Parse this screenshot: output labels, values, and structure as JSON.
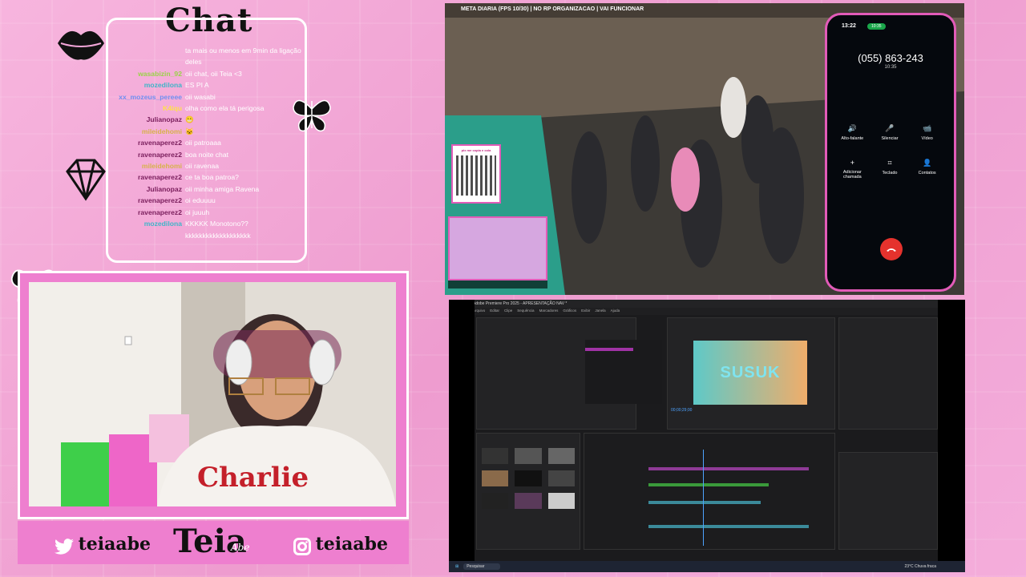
{
  "chat": {
    "title": "Chat",
    "messages": [
      {
        "user": "",
        "text": "ta mais ou menos em 9min da ligação deles",
        "color": "#ffffff"
      },
      {
        "user": "wasabizin_92",
        "text": "oii chat, oii Teia <3",
        "color": "#9ad34a"
      },
      {
        "user": "mozedilona",
        "text": "ES PI A",
        "color": "#3fb6c9"
      },
      {
        "user": "xx_mozeus_pereee",
        "text": "oii wasabi",
        "color": "#6f8ef0"
      },
      {
        "user": "K4iqu",
        "text": "olha como ela tá perigosa",
        "color": "#ffe04a"
      },
      {
        "user": "Julianopaz",
        "text": "😬",
        "color": "#7a1e5c"
      },
      {
        "user": "mileidehomi",
        "text": "🐱",
        "color": "#d7b24a"
      },
      {
        "user": "ravenaperez2",
        "text": "oii patroaaa",
        "color": "#7a1e5c"
      },
      {
        "user": "ravenaperez2",
        "text": "boa noite chat",
        "color": "#7a1e5c"
      },
      {
        "user": "mileidehomi",
        "text": "oii ravenaa",
        "color": "#d7b24a"
      },
      {
        "user": "ravenaperez2",
        "text": "ce ta boa patroa?",
        "color": "#7a1e5c"
      },
      {
        "user": "Julianopaz",
        "text": "oii minha amiga Ravena",
        "color": "#7a1e5c"
      },
      {
        "user": "ravenaperez2",
        "text": "oi eduuuu",
        "color": "#7a1e5c"
      },
      {
        "user": "ravenaperez2",
        "text": "oi juuuh",
        "color": "#7a1e5c"
      },
      {
        "user": "mozedilona",
        "text": "KKKKK Monotono?? kkkkkkkkkkkkkkkkkkk",
        "color": "#3fb6c9"
      }
    ]
  },
  "footer": {
    "twitter": "teiaabe",
    "logo": "Teia",
    "logo_sub": "Abe",
    "instagram": "teiaabe"
  },
  "game": {
    "topbar": "META DIARIA (FPS 10/30) | NO RP ORGANIZACAO | VAI FUNCIONAR",
    "qr_label": "pix me copia e cola"
  },
  "phone": {
    "time": "13:22",
    "call_badge": "10:35",
    "number": "(055) 863-243",
    "duration": "10:35",
    "actions": [
      "Alto-falante",
      "Silenciar",
      "Vídeo",
      "Adicionar chamada",
      "Teclado",
      "Contatos"
    ]
  },
  "premiere": {
    "title": "Adobe Premiere Pro 2025 - APRESENTAÇÃO NAV *",
    "menu": [
      "Arquivo",
      "Editar",
      "Clipe",
      "Sequência",
      "Marcadores",
      "Gráficos",
      "Exibir",
      "Janela",
      "Ajuda"
    ],
    "preview_text": "SUSUK",
    "timecode": "00;00;29;00",
    "search_placeholder": "Pesquisar",
    "weather": "23°C Chuva fraca"
  }
}
